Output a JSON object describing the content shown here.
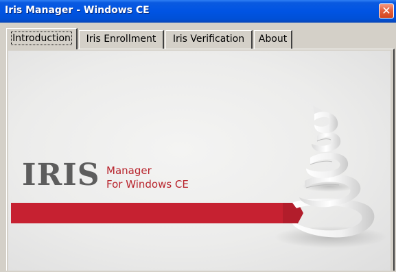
{
  "window": {
    "title": "Iris Manager - Windows CE",
    "close_glyph": "✕"
  },
  "tabs": [
    {
      "label": "Introduction",
      "active": true
    },
    {
      "label": "Iris Enrollment",
      "active": false
    },
    {
      "label": "Iris Verification",
      "active": false
    },
    {
      "label": "About",
      "active": false
    }
  ],
  "splash": {
    "logo_text": "IRIS",
    "subtitle_line1": "Manager",
    "subtitle_line2": "For Windows CE",
    "colors": {
      "accent_red": "#c62131",
      "logo_gray": "#5d5d5d",
      "background": "#ececeb"
    },
    "decor_icon": "paper-ribbon-spiral"
  }
}
